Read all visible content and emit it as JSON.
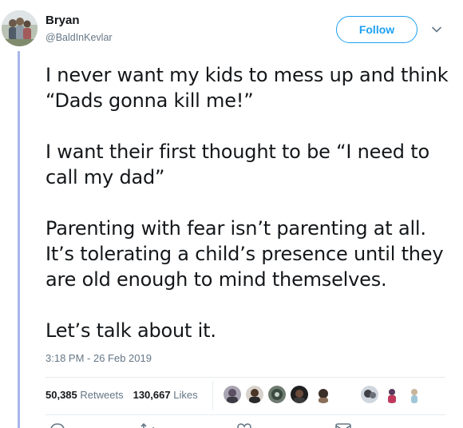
{
  "user": {
    "display_name": "Bryan",
    "handle": "@BaldInKevlar"
  },
  "follow_button": {
    "label": "Follow"
  },
  "tweet": {
    "paragraphs": [
      "I never want my kids to mess up and think “Dads gonna kill me!”",
      "I want their first thought to be “I need to call my dad”",
      "Parenting with fear isn’t parenting at all. It’s tolerating a child’s presence until they are old enough to mind themselves.",
      "Let’s talk about it."
    ],
    "timestamp": "3:18 PM - 26 Feb 2019"
  },
  "stats": {
    "retweets_count": "50,385",
    "retweets_label": "Retweets",
    "likes_count": "130,667",
    "likes_label": "Likes"
  },
  "colors": {
    "accent": "#1da1f2",
    "thread_line": "#a8b6ec",
    "muted_text": "#657786"
  },
  "icons": {
    "menu": "chevron-down-icon",
    "actions": [
      "reply-icon",
      "retweet-icon",
      "like-icon",
      "message-icon"
    ]
  }
}
